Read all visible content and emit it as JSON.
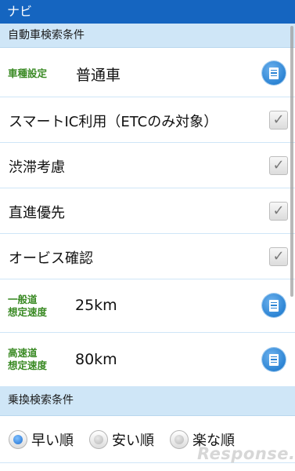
{
  "title_bar": {
    "title": "ナビ"
  },
  "car_section": {
    "header": "自動車検索条件",
    "vehicle_type": {
      "label": "車種設定",
      "value": "普通車"
    },
    "options": [
      {
        "label": "スマートIC利用（ETCのみ対象）",
        "checked": true
      },
      {
        "label": "渋滞考慮",
        "checked": true
      },
      {
        "label": "直進優先",
        "checked": true
      },
      {
        "label": "オービス確認",
        "checked": true
      }
    ],
    "general_road_speed": {
      "label_line1": "一般道",
      "label_line2": "想定速度",
      "value": "25km"
    },
    "highway_speed": {
      "label_line1": "高速道",
      "label_line2": "想定速度",
      "value": "80km"
    }
  },
  "transfer_section": {
    "header": "乗換検索条件",
    "sort_options": [
      {
        "label": "早い順",
        "selected": true
      },
      {
        "label": "安い順",
        "selected": false
      },
      {
        "label": "楽な順",
        "selected": false
      }
    ]
  },
  "watermark": "Response.",
  "icons": {
    "list_button": "list-icon",
    "checkbox": "checkmark-icon"
  }
}
